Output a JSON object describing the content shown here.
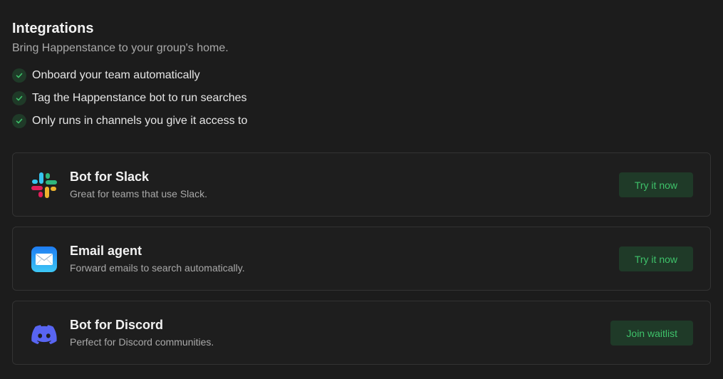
{
  "header": {
    "title": "Integrations",
    "subtitle": "Bring Happenstance to your group's home."
  },
  "features": [
    "Onboard your team automatically",
    "Tag the Happenstance bot to run searches",
    "Only runs in channels you give it access to"
  ],
  "integrations": [
    {
      "icon": "slack-logo-icon",
      "title": "Bot for Slack",
      "description": "Great for teams that use Slack.",
      "button": "Try it now"
    },
    {
      "icon": "mail-icon",
      "title": "Email agent",
      "description": "Forward emails to search automatically.",
      "button": "Try it now"
    },
    {
      "icon": "discord-logo-icon",
      "title": "Bot for Discord",
      "description": "Perfect for Discord communities.",
      "button": "Join waitlist"
    }
  ],
  "colors": {
    "background": "#1c1c1c",
    "accent": "#3ec26a",
    "button_bg": "#1f3a28",
    "card_border": "#333333",
    "discord": "#5865f2"
  }
}
